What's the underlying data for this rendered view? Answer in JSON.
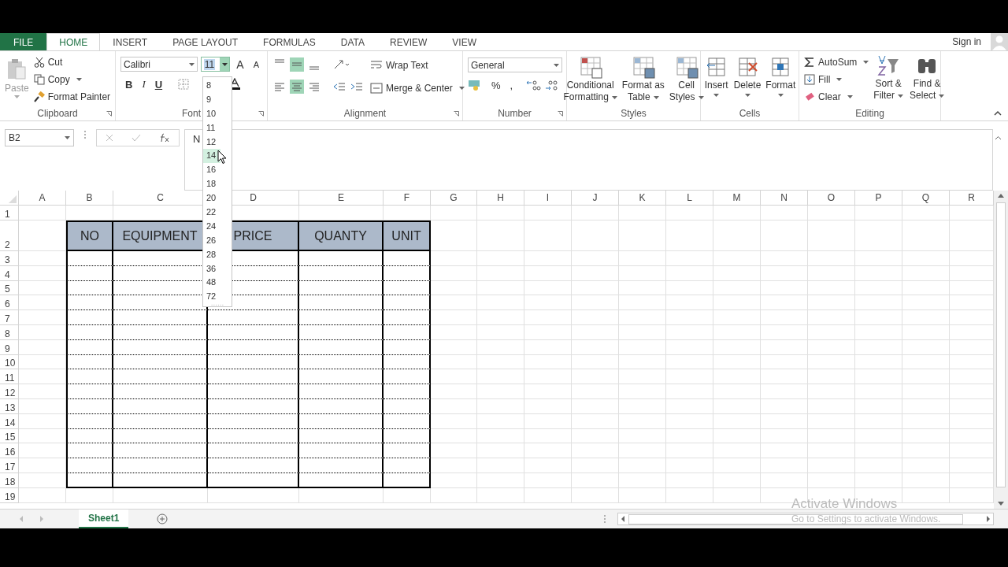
{
  "tabs": [
    {
      "label": "FILE",
      "kind": "file",
      "selected": false
    },
    {
      "label": "HOME",
      "kind": "tab",
      "selected": true
    },
    {
      "label": "INSERT",
      "kind": "tab",
      "selected": false
    },
    {
      "label": "PAGE LAYOUT",
      "kind": "tab",
      "selected": false
    },
    {
      "label": "FORMULAS",
      "kind": "tab",
      "selected": false
    },
    {
      "label": "DATA",
      "kind": "tab",
      "selected": false
    },
    {
      "label": "REVIEW",
      "kind": "tab",
      "selected": false
    },
    {
      "label": "VIEW",
      "kind": "tab",
      "selected": false
    }
  ],
  "sign_in": "Sign in",
  "clipboard": {
    "paste": "Paste",
    "cut": "Cut",
    "copy": "Copy",
    "format_painter": "Format Painter",
    "label": "Clipboard"
  },
  "font": {
    "name": "Calibri",
    "size": "11",
    "grow": "A",
    "shrink": "A",
    "bold": "B",
    "italic": "I",
    "underline": "U",
    "label": "Font"
  },
  "alignment": {
    "wrap_text": "Wrap Text",
    "merge_center": "Merge & Center",
    "label": "Alignment"
  },
  "number": {
    "format": "General",
    "percent": "%",
    "comma": ",",
    "label": "Number"
  },
  "styles": {
    "items": [
      {
        "lines": [
          "Conditional",
          "Formatting"
        ]
      },
      {
        "lines": [
          "Format as",
          "Table"
        ]
      },
      {
        "lines": [
          "Cell",
          "Styles"
        ]
      }
    ],
    "label": "Styles"
  },
  "cells": {
    "items": [
      "Insert",
      "Delete",
      "Format"
    ],
    "label": "Cells"
  },
  "editing": {
    "autosum": "AutoSum",
    "fill": "Fill",
    "clear": "Clear",
    "sort": [
      "Sort &",
      "Filter"
    ],
    "find": [
      "Find &",
      "Select"
    ],
    "label": "Editing"
  },
  "name_box": "B2",
  "formula": "N",
  "font_sizes": [
    {
      "label": "8",
      "selected": false
    },
    {
      "label": "9",
      "selected": false
    },
    {
      "label": "10",
      "selected": false
    },
    {
      "label": "11",
      "selected": false
    },
    {
      "label": "12",
      "selected": false
    },
    {
      "label": "14",
      "selected": true
    },
    {
      "label": "16",
      "selected": false
    },
    {
      "label": "18",
      "selected": false
    },
    {
      "label": "20",
      "selected": false
    },
    {
      "label": "22",
      "selected": false
    },
    {
      "label": "24",
      "selected": false
    },
    {
      "label": "26",
      "selected": false
    },
    {
      "label": "28",
      "selected": false
    },
    {
      "label": "36",
      "selected": false
    },
    {
      "label": "48",
      "selected": false
    },
    {
      "label": "72",
      "selected": false
    }
  ],
  "columns": [
    "A",
    "B",
    "C",
    "D",
    "E",
    "F",
    "G",
    "H",
    "I",
    "J",
    "K",
    "L",
    "M",
    "N",
    "O",
    "P",
    "Q",
    "R"
  ],
  "rows": [
    "1",
    "2",
    "3",
    "4",
    "5",
    "6",
    "7",
    "8",
    "9",
    "10",
    "11",
    "12",
    "13",
    "14",
    "15",
    "16",
    "17",
    "18",
    "19"
  ],
  "table": {
    "columns": [
      "NO",
      "EQUIPMENT",
      "PRICE",
      "QUANTY",
      "UNIT"
    ]
  },
  "sheet_tabs": [
    {
      "label": "Sheet1",
      "selected": true
    }
  ],
  "activation": {
    "title": "Activate Windows",
    "subtitle": "Go to Settings to activate Windows."
  }
}
